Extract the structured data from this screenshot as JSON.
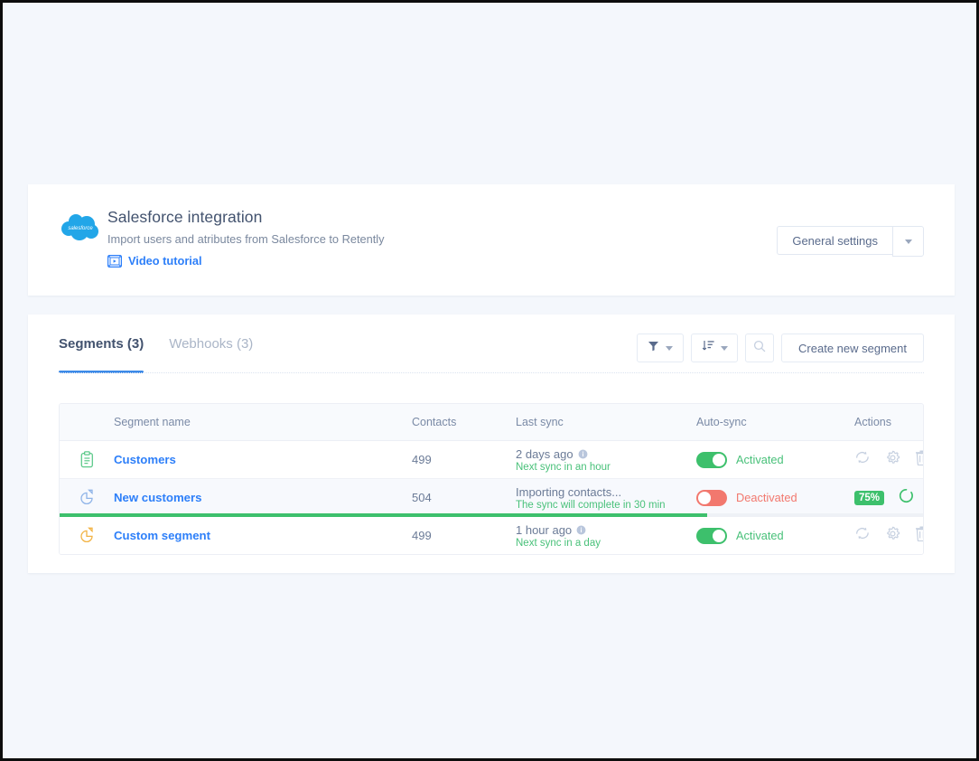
{
  "header": {
    "logo_alt": "salesforce",
    "title": "Salesforce integration",
    "subtitle": "Import users and atributes from Salesforce to Retently",
    "video_link": "Video tutorial",
    "settings_button": "General settings"
  },
  "tabs": [
    {
      "label": "Segments (3)",
      "active": true
    },
    {
      "label": "Webhooks (3)",
      "active": false
    }
  ],
  "toolbar": {
    "filter_icon": "filter-icon",
    "sort_icon": "sort-icon",
    "search_icon": "search-icon",
    "create_button": "Create new segment"
  },
  "table": {
    "columns": [
      "Segment name",
      "Contacts",
      "Last sync",
      "Auto-sync",
      "Actions"
    ],
    "rows": [
      {
        "icon": "clipboard-icon",
        "name": "Customers",
        "contacts": "499",
        "sync_main": "2 days ago",
        "sync_sub": "Next sync in an hour",
        "auto_sync_state": "Activated",
        "auto_sync_on": true,
        "progress": null,
        "percent": null
      },
      {
        "icon": "pie-chart-icon",
        "name": "New customers",
        "contacts": "504",
        "sync_main": "Importing contacts...",
        "sync_sub": "The sync will complete in 30 min",
        "auto_sync_state": "Deactivated",
        "auto_sync_on": false,
        "progress": 75,
        "percent": "75%"
      },
      {
        "icon": "pie-chart-icon",
        "name": "Custom segment",
        "contacts": "499",
        "sync_main": "1 hour ago",
        "sync_sub": "Next sync in a day",
        "auto_sync_state": "Activated",
        "auto_sync_on": true,
        "progress": null,
        "percent": null
      }
    ]
  },
  "colors": {
    "page_bg": "#f4f7fc",
    "accent_blue": "#2d7ff9",
    "tab_underline": "#3c8ae8",
    "green": "#3dc06c",
    "green_text": "#49c17a",
    "red": "#f2786e",
    "icon_green": "#5cc98a",
    "icon_blue": "#8fb4e8",
    "icon_orange": "#f2b344"
  }
}
